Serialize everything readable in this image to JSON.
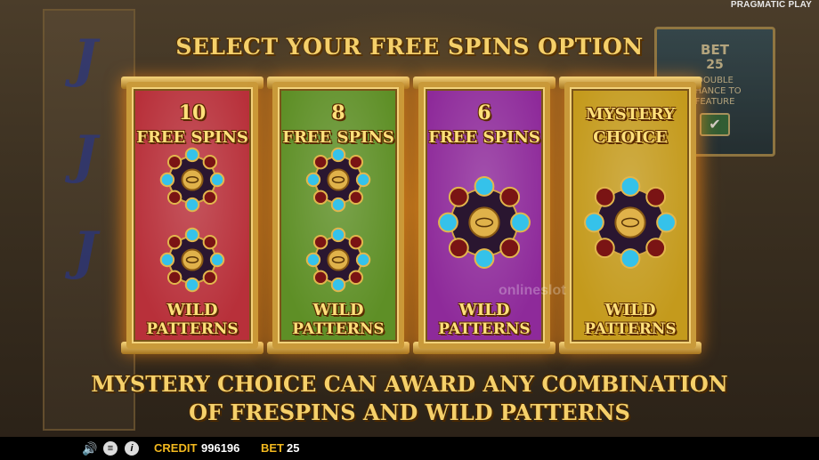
{
  "brand": "PRAGMATIC PLAY",
  "title": "SELECT YOUR FREE SPINS OPTION",
  "background": {
    "reel_symbol": "J",
    "bet_panel": {
      "bet_label": "BET",
      "bet_value": "25",
      "line1": "DOUBLE",
      "line2": "CHANCE TO",
      "line3": "FEATURE",
      "confirm_icon": "checkmark-icon"
    }
  },
  "options": [
    {
      "count": "10",
      "count_label": "FREE SPINS",
      "wild_line1": "WILD",
      "wild_line2": "PATTERNS",
      "color": "#b8303a",
      "patterns": 2
    },
    {
      "count": "8",
      "count_label": "FREE SPINS",
      "wild_line1": "WILD",
      "wild_line2": "PATTERNS",
      "color": "#5e8f26",
      "patterns": 2
    },
    {
      "count": "6",
      "count_label": "FREE SPINS",
      "wild_line1": "WILD",
      "wild_line2": "PATTERNS",
      "color": "#8e2a9a",
      "patterns": 1
    },
    {
      "count": "MYSTERY",
      "count_label": "CHOICE",
      "wild_line1": "WILD",
      "wild_line2": "PATTERNS",
      "color": "#c49a1c",
      "patterns": 1
    }
  ],
  "info_line1": "MYSTERY CHOICE CAN AWARD ANY COMBINATION",
  "info_line2": "OF FRESPINS AND WILD PATTERNS",
  "watermark": "onlineslot",
  "bottom_bar": {
    "sound_icon": "speaker-icon",
    "menu_icon": "menu-icon",
    "info_icon": "info-icon",
    "credit_label": "CREDIT",
    "credit_value": "996196",
    "bet_label": "BET",
    "bet_value": "25"
  }
}
